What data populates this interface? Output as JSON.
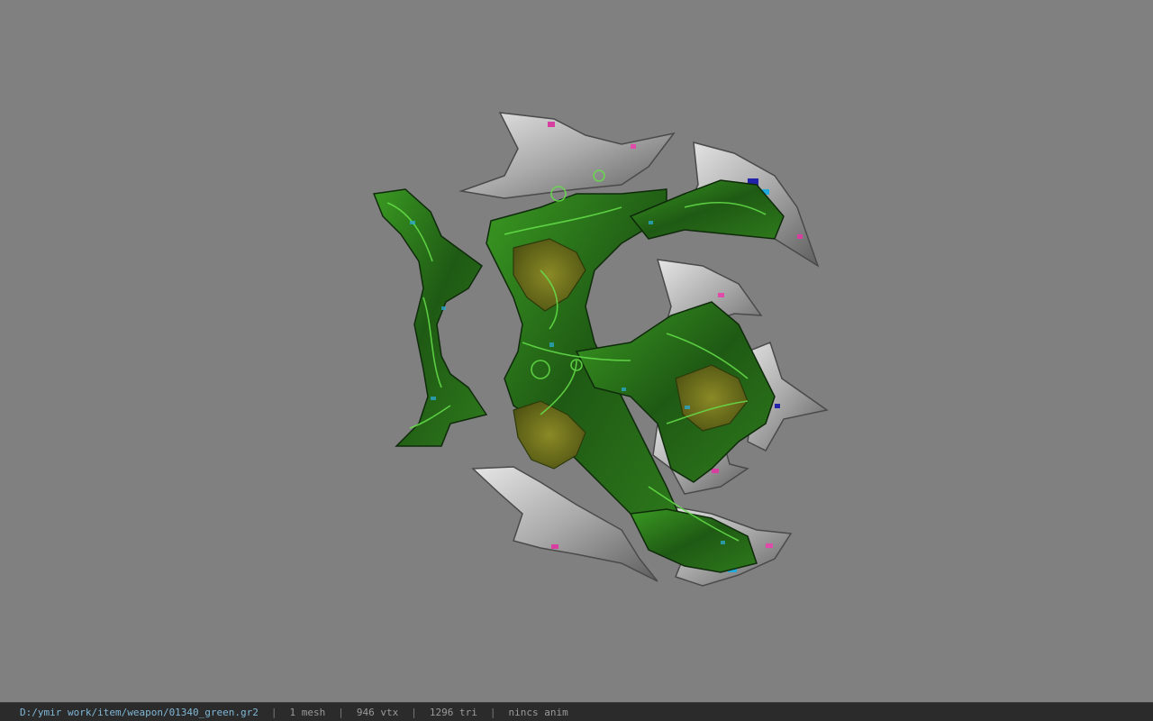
{
  "viewer": {
    "background_color": "#808080",
    "model_icon": "green-shield-weapon-model"
  },
  "status": {
    "file_path": "D:/ymir work/item/weapon/01340_green.gr2",
    "mesh_count": "1 mesh",
    "vertex_count": "946 vtx",
    "triangle_count": "1296 tri",
    "anim_state": "nincs anim",
    "separator": "|"
  },
  "colors": {
    "metal": "#c8c8c8",
    "green_dark": "#1f4d16",
    "green_mid": "#3a8a24",
    "green_light": "#5cc43a",
    "olive": "#6b6a1c",
    "path_text": "#7fb7d6",
    "status_bg": "#2b2b2b"
  }
}
